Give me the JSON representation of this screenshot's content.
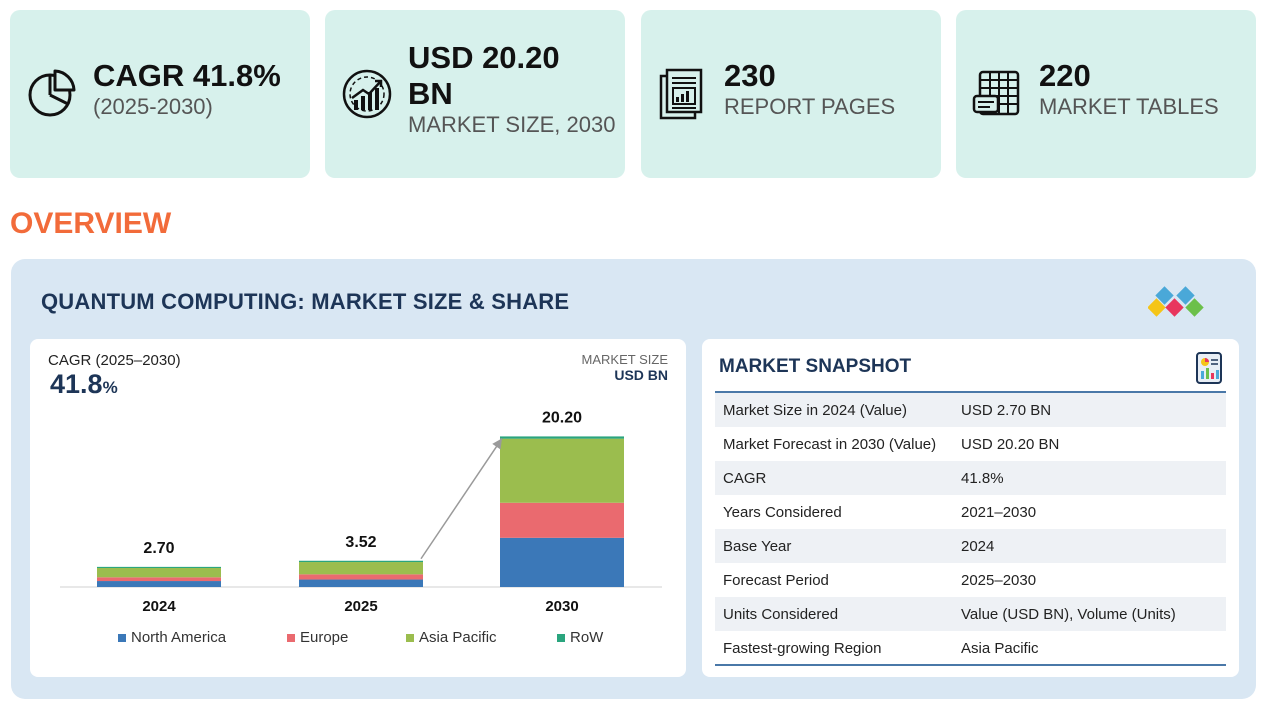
{
  "stats": [
    {
      "value": "CAGR 41.8%",
      "label": "(2025-2030)",
      "icon": "pie-chart-icon"
    },
    {
      "value_line1": "USD 20.20",
      "value_line2": "BN",
      "label": "MARKET SIZE, 2030",
      "icon": "growth-chart-icon"
    },
    {
      "value": "230",
      "label": "REPORT PAGES",
      "icon": "report-pages-icon"
    },
    {
      "value": "220",
      "label": "MARKET TABLES",
      "icon": "market-tables-icon"
    }
  ],
  "overview_heading": "OVERVIEW",
  "panel_title": "QUANTUM COMPUTING: MARKET SIZE & SHARE",
  "chart_header": {
    "cagr_label": "CAGR (2025–2030)",
    "cagr_value": "41.8",
    "cagr_unit": "%",
    "market_size_label": "MARKET SIZE",
    "market_size_unit": "USD BN"
  },
  "chart_data": {
    "type": "bar",
    "stacked": true,
    "categories": [
      "2024",
      "2025",
      "2030"
    ],
    "totals": [
      2.7,
      3.52,
      20.2
    ],
    "total_labels": [
      "2.70",
      "3.52",
      "20.20"
    ],
    "series": [
      {
        "name": "North America",
        "color": "#3b78b8",
        "values": [
          0.8,
          1.0,
          6.6
        ]
      },
      {
        "name": "Europe",
        "color": "#ea6a6f",
        "values": [
          0.5,
          0.7,
          4.7
        ]
      },
      {
        "name": "Asia Pacific",
        "color": "#9bbd4e",
        "values": [
          1.25,
          1.65,
          8.6
        ]
      },
      {
        "name": "RoW",
        "color": "#2aa57e",
        "values": [
          0.15,
          0.17,
          0.3
        ]
      }
    ],
    "ylim": [
      0,
      22
    ],
    "legend_position": "bottom",
    "annotation": "growth arrow from 2025 to 2030"
  },
  "snapshot": {
    "title": "MARKET SNAPSHOT",
    "rows": [
      {
        "key": "Market Size in 2024 (Value)",
        "value": "USD 2.70 BN"
      },
      {
        "key": "Market Forecast in 2030 (Value)",
        "value": "USD 20.20 BN"
      },
      {
        "key": "CAGR",
        "value": "41.8%"
      },
      {
        "key": "Years Considered",
        "value": "2021–2030"
      },
      {
        "key": "Base Year",
        "value": "2024"
      },
      {
        "key": "Forecast Period",
        "value": "2025–2030"
      },
      {
        "key": "Units Considered",
        "value": "Value (USD BN), Volume (Units)"
      },
      {
        "key": "Fastest-growing Region",
        "value": "Asia Pacific"
      }
    ]
  },
  "brand_colors": {
    "stat_card_bg": "#d7f1ec",
    "overview_orange": "#f26b3a",
    "panel_bg": "#d9e7f3",
    "title_navy": "#1d3557"
  }
}
